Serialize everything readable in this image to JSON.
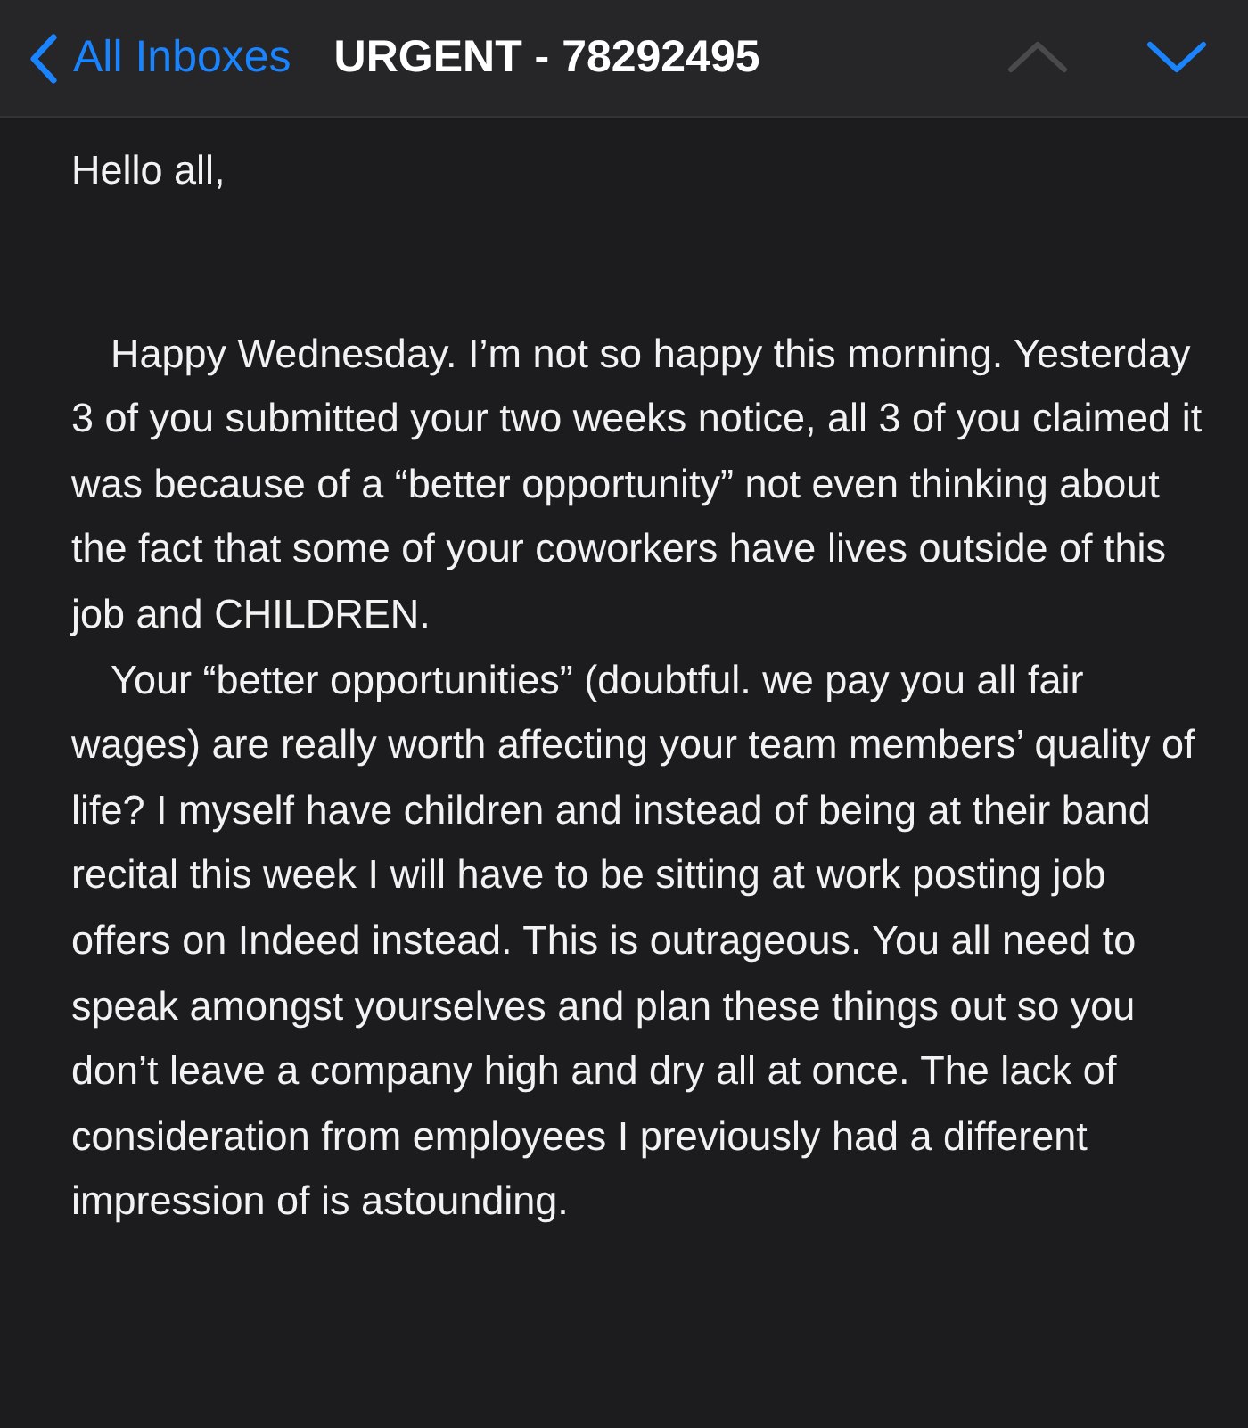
{
  "header": {
    "back_label": "All Inboxes",
    "subject": "URGENT - 78292495",
    "prev_enabled": false,
    "next_enabled": true
  },
  "body": {
    "greeting": "Hello all,",
    "paragraphs": [
      "Happy Wednesday. I’m not so happy this morning. Yesterday 3 of you submitted your two weeks notice, all 3 of you claimed it was because of a “better opportunity” not even thinking about the fact that some of your coworkers have lives outside of this job and CHILDREN.",
      "Your “better opportunities” (doubtful. we pay you all fair wages) are really worth affecting your team members’ quality of life? I myself have children and instead of being at their band recital this week I will have to be sitting at work posting job offers on Indeed instead. This is outrageous. You all need to speak amongst yourselves and plan these things out so you don’t leave a company high and dry all at once. The lack of consideration from employees I previously had a different impression of is astounding."
    ]
  }
}
